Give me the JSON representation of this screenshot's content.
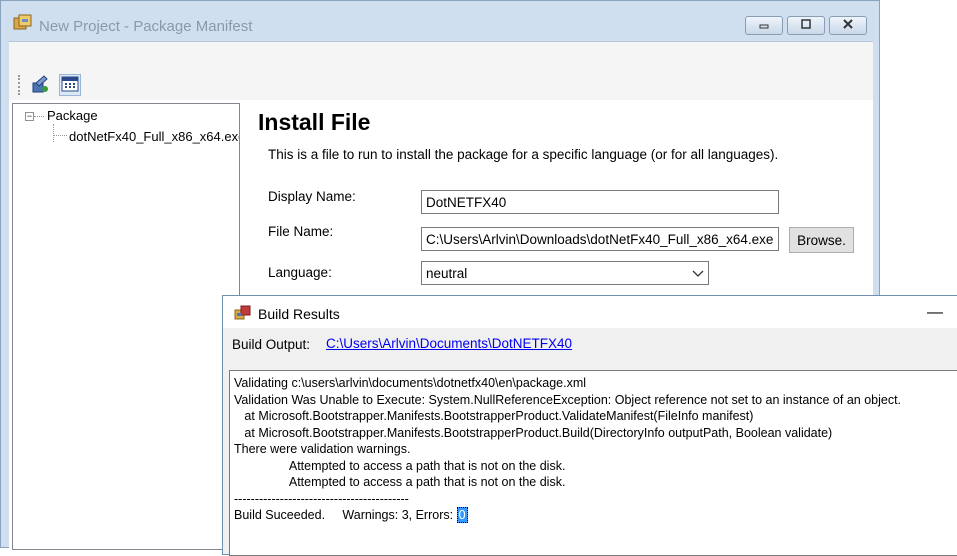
{
  "window": {
    "title": "New Project - Package Manifest",
    "app_icon": "package-project-icon",
    "caption_buttons": [
      "minimize-icon",
      "maximize-icon",
      "close-icon"
    ]
  },
  "toolbar": {
    "buttons": [
      {
        "icon": "build-package-icon"
      },
      {
        "icon": "package-properties-icon"
      }
    ]
  },
  "tree": {
    "root_label": "Package",
    "child_label": "dotNetFx40_Full_x86_x64.exe"
  },
  "details": {
    "heading": "Install File",
    "description": "This is a file to run to install the package for a specific language (or for all languages).",
    "display_name_label": "Display Name:",
    "display_name_value": "DotNETFX40",
    "file_name_label": "File Name:",
    "file_name_value": "C:\\Users\\Arlvin\\Downloads\\dotNetFx40_Full_x86_x64.exe",
    "browse_label": "Browse.",
    "language_label": "Language:",
    "language_value": "neutral"
  },
  "build_results": {
    "title": "Build Results",
    "output_label": "Build Output:",
    "output_path": "C:\\Users\\Arlvin\\Documents\\DotNETFX40",
    "log_lines": [
      "Validating c:\\users\\arlvin\\documents\\dotnetfx40\\en\\package.xml",
      "Validation Was Unable to Execute: System.NullReferenceException: Object reference not set to an instance of an object.",
      "   at Microsoft.Bootstrapper.Manifests.BootstrapperProduct.ValidateManifest(FileInfo manifest)",
      "   at Microsoft.Bootstrapper.Manifests.BootstrapperProduct.Build(DirectoryInfo outputPath, Boolean validate)",
      "There were validation warnings.",
      "                Attempted to access a path that is not on the disk.",
      "                Attempted to access a path that is not on the disk.",
      "",
      "------------------------------------------"
    ],
    "summary_status": "Build Suceeded.",
    "summary_warnings": "     Warnings: 3, Errors: ",
    "errors_count": "0"
  }
}
